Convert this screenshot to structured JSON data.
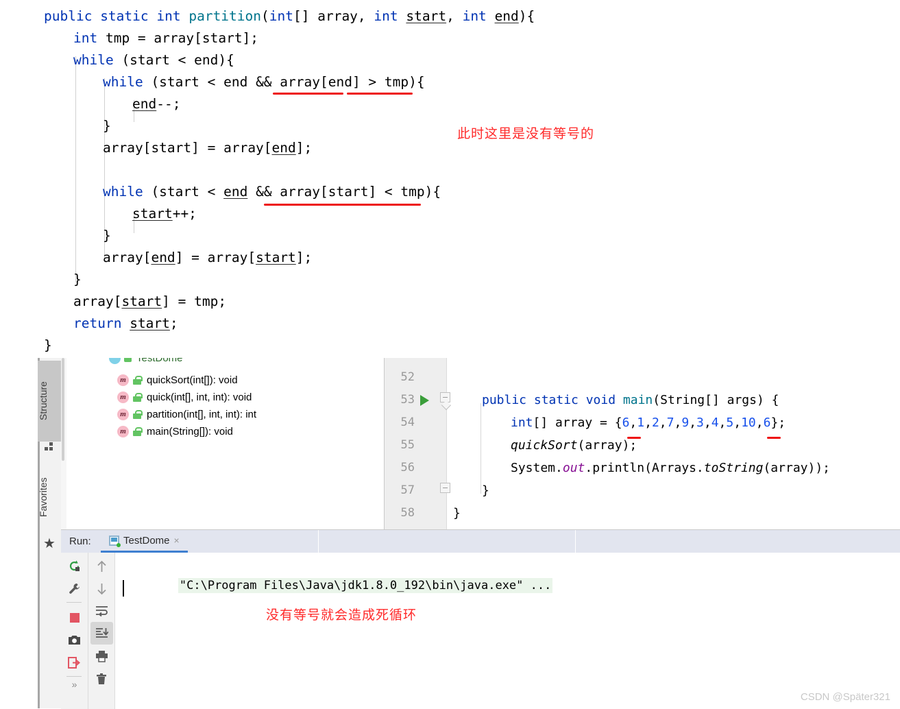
{
  "top_code": {
    "lines": [
      {
        "indent": 0,
        "tokens": [
          {
            "t": "public ",
            "c": "kw"
          },
          {
            "t": "static ",
            "c": "kw"
          },
          {
            "t": "int ",
            "c": "kw"
          },
          {
            "t": "partition",
            "c": "meth"
          },
          {
            "t": "(",
            "c": ""
          },
          {
            "t": "int",
            "c": "kw"
          },
          {
            "t": "[] array, ",
            "c": ""
          },
          {
            "t": "int",
            "c": "kw"
          },
          {
            "t": " ",
            "c": ""
          },
          {
            "t": "start",
            "c": "fld"
          },
          {
            "t": ", ",
            "c": ""
          },
          {
            "t": "int",
            "c": "kw"
          },
          {
            "t": " ",
            "c": ""
          },
          {
            "t": "end",
            "c": "fld"
          },
          {
            "t": "){",
            "c": ""
          }
        ]
      },
      {
        "indent": 1,
        "tokens": [
          {
            "t": "int",
            "c": "kw"
          },
          {
            "t": " tmp = array[start];",
            "c": ""
          }
        ]
      },
      {
        "indent": 1,
        "tokens": [
          {
            "t": "while",
            "c": "kw"
          },
          {
            "t": " (start < end){",
            "c": ""
          }
        ]
      },
      {
        "indent": 2,
        "tokens": [
          {
            "t": "while",
            "c": "kw"
          },
          {
            "t": " (start < end && array[end] > tmp){",
            "c": ""
          }
        ]
      },
      {
        "indent": 3,
        "tokens": [
          {
            "t": "end",
            "c": "fld"
          },
          {
            "t": "--;",
            "c": ""
          }
        ]
      },
      {
        "indent": 2,
        "tokens": [
          {
            "t": "}",
            "c": ""
          }
        ]
      },
      {
        "indent": 2,
        "tokens": [
          {
            "t": "array[start] = array[",
            "c": ""
          },
          {
            "t": "end",
            "c": "fld"
          },
          {
            "t": "];",
            "c": ""
          }
        ]
      },
      {
        "indent": 2,
        "tokens": [
          {
            "t": "",
            "c": ""
          }
        ]
      },
      {
        "indent": 2,
        "tokens": [
          {
            "t": "while",
            "c": "kw"
          },
          {
            "t": " (start < ",
            "c": ""
          },
          {
            "t": "end",
            "c": "fld"
          },
          {
            "t": " && array[start] < tmp){",
            "c": ""
          }
        ]
      },
      {
        "indent": 3,
        "tokens": [
          {
            "t": "start",
            "c": "fld"
          },
          {
            "t": "++;",
            "c": ""
          }
        ]
      },
      {
        "indent": 2,
        "tokens": [
          {
            "t": "}",
            "c": ""
          }
        ]
      },
      {
        "indent": 2,
        "tokens": [
          {
            "t": "array[",
            "c": ""
          },
          {
            "t": "end",
            "c": "fld"
          },
          {
            "t": "] = array[",
            "c": ""
          },
          {
            "t": "start",
            "c": "fld"
          },
          {
            "t": "];",
            "c": ""
          }
        ]
      },
      {
        "indent": 1,
        "tokens": [
          {
            "t": "}",
            "c": ""
          }
        ]
      },
      {
        "indent": 1,
        "tokens": [
          {
            "t": "array[",
            "c": ""
          },
          {
            "t": "start",
            "c": "fld"
          },
          {
            "t": "] = tmp;",
            "c": ""
          }
        ]
      },
      {
        "indent": 1,
        "tokens": [
          {
            "t": "return",
            "c": "kw"
          },
          {
            "t": " ",
            "c": ""
          },
          {
            "t": "start",
            "c": "fld"
          },
          {
            "t": ";",
            "c": ""
          }
        ]
      },
      {
        "indent": 0,
        "tokens": [
          {
            "t": "}",
            "c": ""
          }
        ]
      }
    ]
  },
  "annotations": {
    "note_no_equals": "此时这里是没有等号的",
    "note_infinite_loop": "没有等号就会造成死循环"
  },
  "left_tool_bar": {
    "tabs": [
      {
        "label": "Structure",
        "icon": "structure-icon",
        "active": true
      },
      {
        "label": "Favorites",
        "icon": "star-icon",
        "active": false
      }
    ]
  },
  "structure_panel": {
    "root": "TestDome",
    "items": [
      {
        "label": "quickSort(int[]): void",
        "icon": "method-icon",
        "visibility": "public-lock-icon"
      },
      {
        "label": "quick(int[], int, int): void",
        "icon": "method-icon",
        "visibility": "public-lock-icon"
      },
      {
        "label": "partition(int[], int, int): int",
        "icon": "method-icon",
        "visibility": "public-lock-icon"
      },
      {
        "label": "main(String[]): void",
        "icon": "method-icon",
        "visibility": "public-lock-icon"
      }
    ]
  },
  "editor": {
    "line_numbers": [
      "52",
      "53",
      "54",
      "55",
      "56",
      "57",
      "58"
    ],
    "run_marker_line": "53",
    "lines": [
      {
        "indent": 0,
        "tokens": [
          {
            "t": "",
            "c": ""
          }
        ]
      },
      {
        "indent": 1,
        "tokens": [
          {
            "t": "public ",
            "c": "kw"
          },
          {
            "t": "static ",
            "c": "kw"
          },
          {
            "t": "void ",
            "c": "kw"
          },
          {
            "t": "main",
            "c": "meth"
          },
          {
            "t": "(String[] args) {",
            "c": ""
          }
        ]
      },
      {
        "indent": 2,
        "tokens": [
          {
            "t": "int",
            "c": "kw"
          },
          {
            "t": "[] array = {",
            "c": ""
          },
          {
            "t": "6",
            "c": "num"
          },
          {
            "t": ",",
            "c": ""
          },
          {
            "t": "1",
            "c": "num"
          },
          {
            "t": ",",
            "c": ""
          },
          {
            "t": "2",
            "c": "num"
          },
          {
            "t": ",",
            "c": ""
          },
          {
            "t": "7",
            "c": "num"
          },
          {
            "t": ",",
            "c": ""
          },
          {
            "t": "9",
            "c": "num"
          },
          {
            "t": ",",
            "c": ""
          },
          {
            "t": "3",
            "c": "num"
          },
          {
            "t": ",",
            "c": ""
          },
          {
            "t": "4",
            "c": "num"
          },
          {
            "t": ",",
            "c": ""
          },
          {
            "t": "5",
            "c": "num"
          },
          {
            "t": ",",
            "c": ""
          },
          {
            "t": "10",
            "c": "num"
          },
          {
            "t": ",",
            "c": ""
          },
          {
            "t": "6",
            "c": "num"
          },
          {
            "t": "};",
            "c": ""
          }
        ]
      },
      {
        "indent": 2,
        "tokens": [
          {
            "t": "quickSort",
            "c": "ital"
          },
          {
            "t": "(array);",
            "c": ""
          }
        ]
      },
      {
        "indent": 2,
        "tokens": [
          {
            "t": "System.",
            "c": ""
          },
          {
            "t": "out",
            "c": "fldpurple"
          },
          {
            "t": ".println(Arrays.",
            "c": ""
          },
          {
            "t": "toString",
            "c": "ital"
          },
          {
            "t": "(array));",
            "c": ""
          }
        ]
      },
      {
        "indent": 1,
        "tokens": [
          {
            "t": "}",
            "c": ""
          }
        ]
      },
      {
        "indent": 0,
        "tokens": [
          {
            "t": "}",
            "c": ""
          }
        ]
      }
    ]
  },
  "run_window": {
    "label": "Run:",
    "tab": {
      "name": "TestDome",
      "close": "×",
      "icon": "application-run-icon"
    },
    "console_output": "\"C:\\Program Files\\Java\\jdk1.8.0_192\\bin\\java.exe\" ...",
    "left_toolbar": [
      {
        "name": "rerun-icon",
        "title": "Rerun"
      },
      {
        "name": "wrench-icon",
        "title": "Edit Configuration"
      },
      {
        "name": "stop-icon",
        "title": "Stop"
      },
      {
        "name": "camera-icon",
        "title": "Dump Threads"
      },
      {
        "name": "exit-icon",
        "title": "Exit"
      }
    ],
    "right_toolbar": [
      {
        "name": "arrow-up-icon",
        "title": "Up"
      },
      {
        "name": "arrow-down-icon",
        "title": "Down"
      },
      {
        "name": "soft-wrap-icon",
        "title": "Soft-Wrap"
      },
      {
        "name": "scroll-to-end-icon",
        "title": "Scroll to End",
        "selected": true
      },
      {
        "name": "print-icon",
        "title": "Print"
      },
      {
        "name": "trash-icon",
        "title": "Clear All"
      }
    ],
    "expand_button": "»"
  },
  "watermark": "CSDN @Später321",
  "colors": {
    "keyword": "#0033b3",
    "method": "#00748c",
    "number": "#1750eb",
    "annotation_red": "#ff2a2a",
    "tab_bar": "#e2e5ef",
    "accent": "#3f7fd0"
  }
}
